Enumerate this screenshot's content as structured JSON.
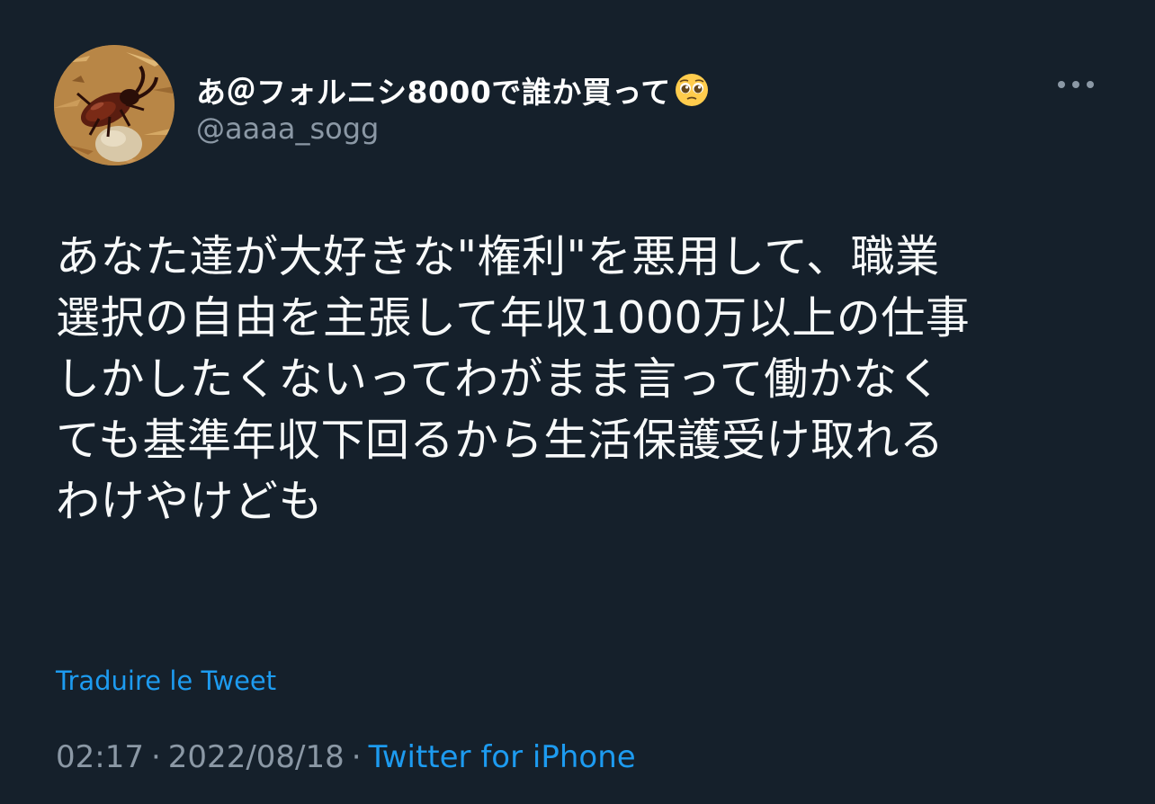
{
  "tweet": {
    "display_name": "あ＠フォルニシ8000で誰か買って",
    "display_name_emoji": "pleading-face-emoji",
    "handle": "@aaaa_sogg",
    "text": "あなた達が大好きな\"権利\"を悪用して、職業\n選択の自由を主張して年収1000万以上の仕事\nしかしたくないってわがまま言って働かなく\nても基準年収下回るから生活保護受け取れる\nわけやけども",
    "translate_label": "Traduire le Tweet",
    "time": "02:17",
    "date": "2022/08/18",
    "separator": "·",
    "source": "Twitter for iPhone"
  },
  "icons": {
    "avatar": "beetle-avatar",
    "more": "more-icon"
  },
  "colors": {
    "background": "#15202b",
    "text": "#f7f9f9",
    "secondary": "#8b98a5",
    "accent": "#1d9bf0"
  }
}
